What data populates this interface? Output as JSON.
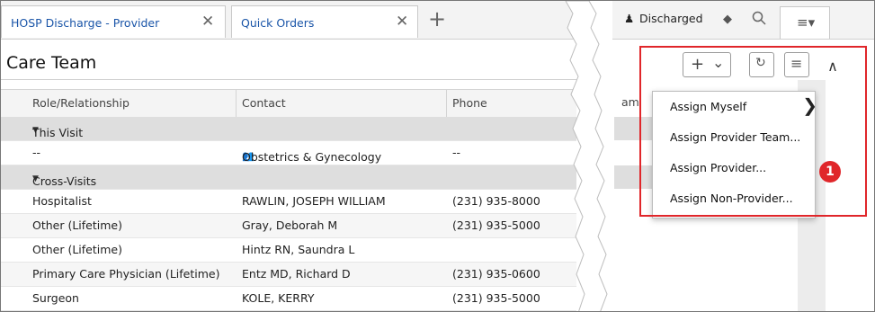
{
  "tabs": [
    {
      "label": "HOSP Discharge - Provider",
      "close": "✕"
    },
    {
      "label": "Quick Orders",
      "close": "✕"
    }
  ],
  "add_tab": "+",
  "panel_title": "Care Team",
  "table": {
    "columns": [
      "Role/Relationship",
      "Contact",
      "Phone"
    ],
    "partial_column": "am",
    "groups": [
      {
        "label": "This Visit",
        "rows": [
          {
            "role": "--",
            "contact": "Obstetrics & Gynecology",
            "phone": "--",
            "contact_icon": "team-icon"
          }
        ]
      },
      {
        "label": "Cross-Visits",
        "rows": [
          {
            "role": "Hospitalist",
            "contact": "RAWLIN, JOSEPH WILLIAM",
            "phone": "(231) 935-8000"
          },
          {
            "role": "Other (Lifetime)",
            "contact": "Gray, Deborah M",
            "phone": "(231) 935-5000"
          },
          {
            "role": "Other (Lifetime)",
            "contact": "Hintz RN, Saundra L",
            "phone": ""
          },
          {
            "role": "Primary Care Physician (Lifetime)",
            "contact": "Entz MD, Richard D",
            "phone": "(231) 935-0600"
          },
          {
            "role": "Surgeon",
            "contact": "KOLE, KERRY",
            "phone": "(231) 935-5000"
          }
        ]
      }
    ]
  },
  "status": {
    "label": "Discharged",
    "icon": "person-icon"
  },
  "toolbar": {
    "add": "+",
    "dropdown": "⌄",
    "refresh": "↻",
    "menu": "≡",
    "collapse": "∧"
  },
  "menu": {
    "items": [
      "Assign Myself",
      "Assign Provider Team...",
      "Assign Provider...",
      "Assign Non-Provider..."
    ],
    "submenu_arrow": "❯"
  },
  "callout": "1",
  "colors": {
    "link": "#1a55a8",
    "highlight": "#e0262a",
    "group_bg": "#dedede"
  }
}
